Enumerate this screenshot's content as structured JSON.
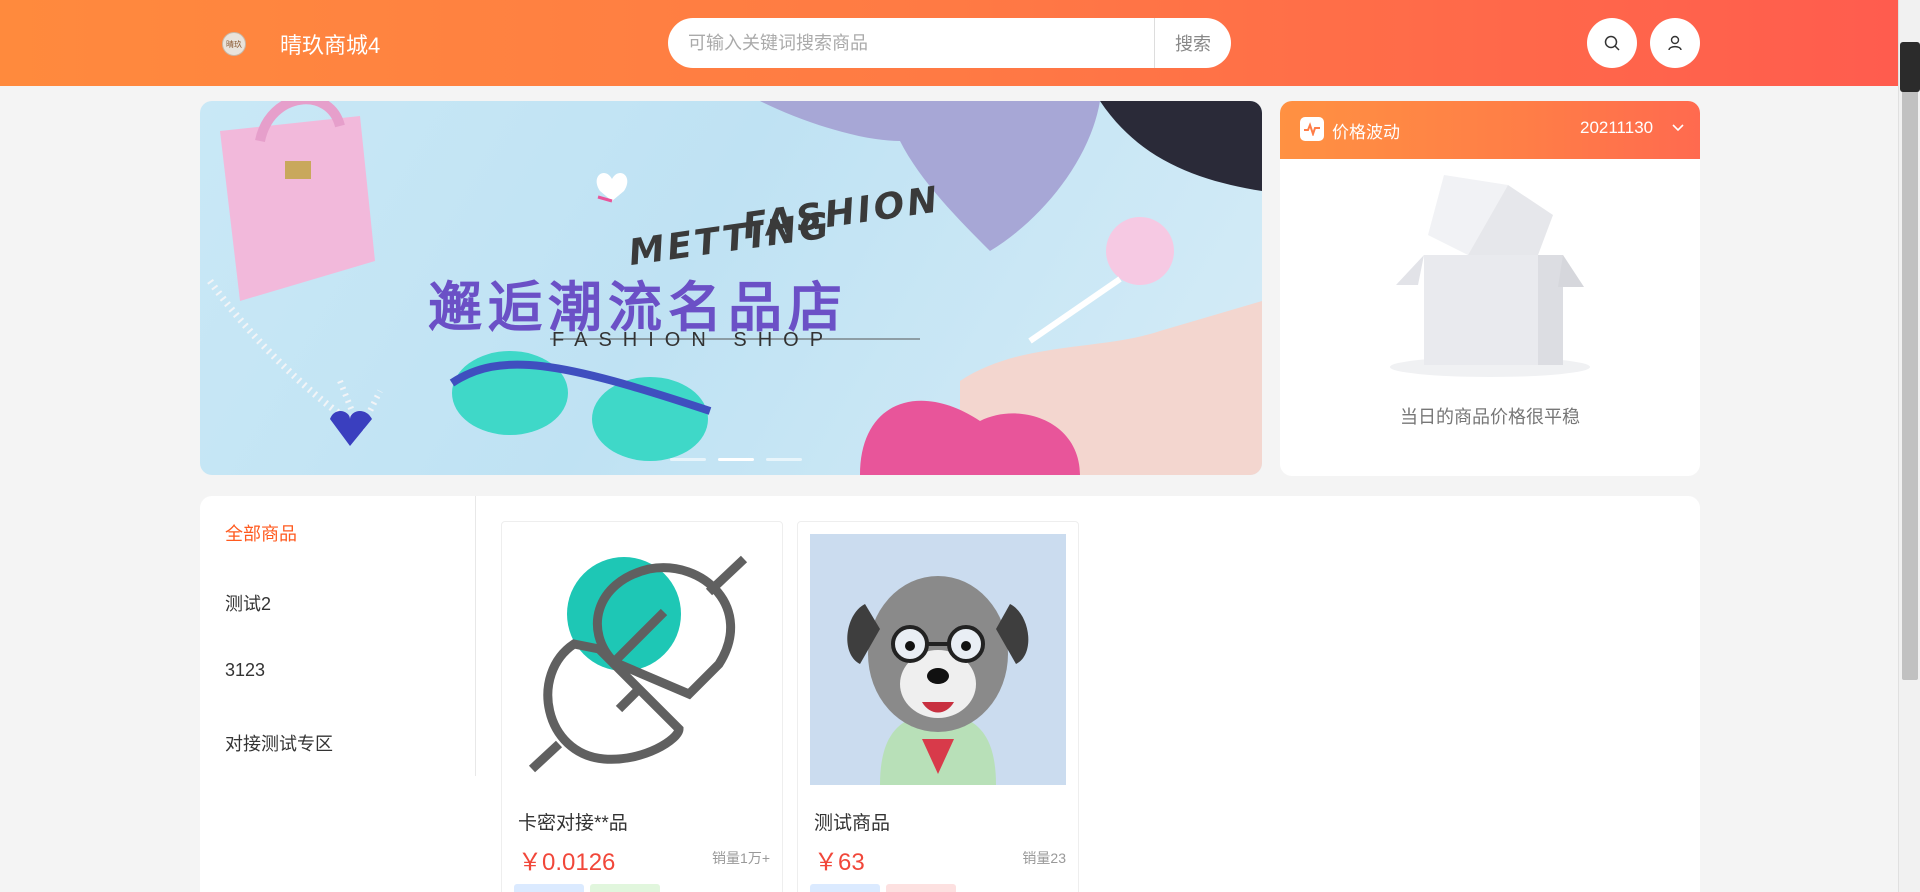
{
  "header": {
    "logo_text": "晴玖",
    "title": "晴玖商城4",
    "search": {
      "placeholder": "可输入关键词搜索商品",
      "value": "",
      "button": "搜索"
    },
    "icons": [
      "search-icon",
      "user-icon"
    ]
  },
  "banner": {
    "headline_en_1": "METTING",
    "headline_en_2": "FASHION",
    "headline_cn": "邂逅潮流名品店",
    "subline": "FASHION SHOP",
    "slide_count": 3,
    "active_slide": 2
  },
  "price_panel": {
    "title": "价格波动",
    "date": "20211130",
    "empty_message": "当日的商品价格很平稳"
  },
  "categories": [
    {
      "label": "全部商品",
      "active": true
    },
    {
      "label": "测试2",
      "active": false
    },
    {
      "label": "3123",
      "active": false
    },
    {
      "label": "对接测试专区",
      "active": false
    }
  ],
  "products": [
    {
      "name": "卡密对接**品",
      "price": "￥0.0126",
      "sales": "销量1万+"
    },
    {
      "name": "测试商品",
      "price": "￥63",
      "sales": "销量23"
    }
  ],
  "colors": {
    "accent": "#ff7a44",
    "price": "#f1473a",
    "active_category": "#ff5a1f"
  }
}
